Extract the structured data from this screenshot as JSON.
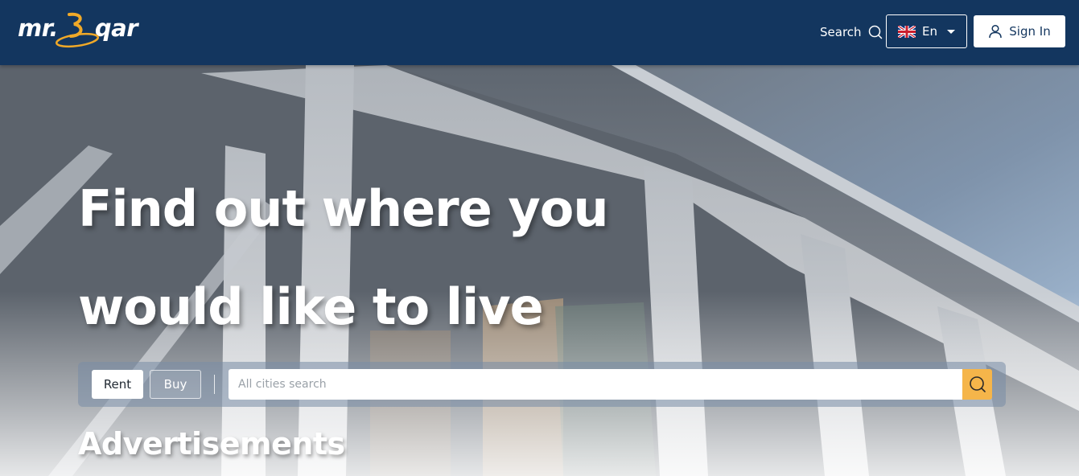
{
  "header": {
    "logo_text_left": "mr.",
    "logo_text_right": "qar",
    "search_label": "Search",
    "language_label": "En",
    "signin_label": "Sign In"
  },
  "hero": {
    "headline_line1": "Find out where you",
    "headline_line2": "would like to live"
  },
  "search": {
    "tabs": [
      {
        "label": "Rent",
        "active": true
      },
      {
        "label": "Buy",
        "active": false
      }
    ],
    "placeholder": "All cities search"
  },
  "sections": {
    "advertisements_title": "Advertisements"
  },
  "colors": {
    "header_bg": "#13365f",
    "accent": "#f5b54a",
    "logo_accent": "#f0a928"
  },
  "icons": {
    "search": "search-icon",
    "flag": "uk-flag-icon",
    "user": "user-icon",
    "caret": "chevron-down-icon"
  }
}
